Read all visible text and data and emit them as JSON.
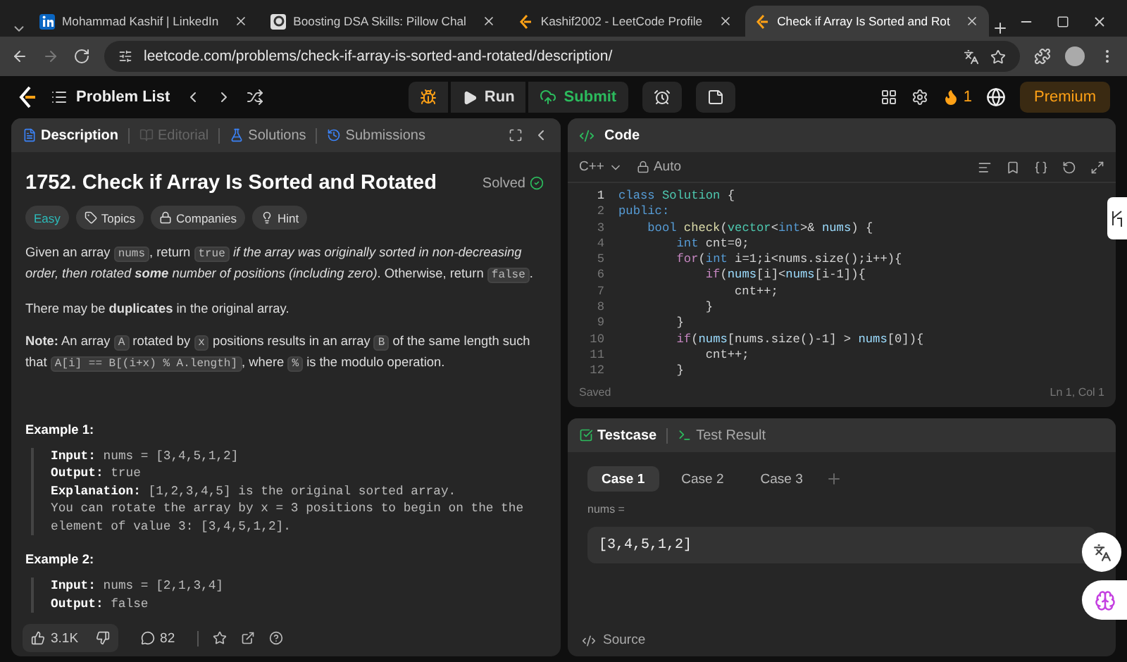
{
  "browser": {
    "tabs": [
      {
        "title": "Mohammad Kashif | LinkedIn",
        "kind": "linkedin",
        "selected": false
      },
      {
        "title": "Boosting DSA Skills: Pillow Chal",
        "kind": "chat",
        "selected": false
      },
      {
        "title": "Kashif2002 - LeetCode Profile",
        "kind": "leetcode",
        "selected": false
      },
      {
        "title": "Check if Array Is Sorted and Rot",
        "kind": "leetcode",
        "selected": true
      }
    ],
    "url": "leetcode.com/problems/check-if-array-is-sorted-and-rotated/description/"
  },
  "navbar": {
    "problem_list": "Problem List",
    "run": "Run",
    "submit": "Submit",
    "streak": "1",
    "premium": "Premium"
  },
  "description_panel": {
    "tabs": [
      {
        "label": "Description",
        "selected": true,
        "disabled": false
      },
      {
        "label": "Editorial",
        "selected": false,
        "disabled": true
      },
      {
        "label": "Solutions",
        "selected": false,
        "disabled": false
      },
      {
        "label": "Submissions",
        "selected": false,
        "disabled": false
      }
    ],
    "title": "1752. Check if Array Is Sorted and Rotated",
    "status": "Solved",
    "difficulty": "Easy",
    "chips": [
      "Topics",
      "Companies",
      "Hint"
    ],
    "paragraphs": [
      [
        {
          "kind": "text",
          "text": "Given an array "
        },
        {
          "kind": "code",
          "text": "nums"
        },
        {
          "kind": "text",
          "text": ", return "
        },
        {
          "kind": "code",
          "text": "true"
        },
        {
          "kind": "em",
          "text": "if the array was originally sorted in non-decreasing order, then rotated **some** number of positions (including zero)"
        },
        {
          "kind": "text",
          "text": ". Otherwise, return "
        },
        {
          "kind": "code",
          "text": "false"
        },
        {
          "kind": "text",
          "text": "."
        }
      ],
      [
        {
          "kind": "text",
          "text": "There may be **duplicates** in the original array."
        }
      ],
      [
        {
          "kind": "text",
          "text": "**Note:** An array "
        },
        {
          "kind": "code",
          "text": "A"
        },
        {
          "kind": "text",
          "text": " rotated by "
        },
        {
          "kind": "code",
          "text": "x"
        },
        {
          "kind": "text",
          "text": " positions results in an array "
        },
        {
          "kind": "code",
          "text": "B"
        },
        {
          "kind": "text",
          "text": " of the same length such that "
        },
        {
          "kind": "code",
          "text": "A[i] == B[(i+x) % A.length]"
        },
        {
          "kind": "text",
          "text": ", where "
        },
        {
          "kind": "code",
          "text": "%"
        },
        {
          "kind": "text",
          "text": " is the modulo operation."
        }
      ]
    ],
    "examples": [
      {
        "title": "Example 1:",
        "lines": [
          {
            "label": "Input:",
            "value": "nums = [3,4,5,1,2]"
          },
          {
            "label": "Output:",
            "value": "true"
          },
          {
            "label": "Explanation:",
            "value": "[1,2,3,4,5] is the original sorted array."
          },
          {
            "value": "You can rotate the array by x = 3 positions to begin on the the"
          },
          {
            "value": "element of value 3: [3,4,5,1,2]."
          }
        ]
      },
      {
        "title": "Example 2:",
        "lines": [
          {
            "label": "Input:",
            "value": "nums = [2,1,3,4]"
          },
          {
            "label": "Output:",
            "value": "false"
          }
        ]
      }
    ],
    "footer": {
      "likes": "3.1K",
      "comments": "82"
    }
  },
  "code_panel": {
    "title": "Code",
    "language": "C++",
    "mode": "Auto",
    "lines": [
      {
        "number": "1",
        "tokens": [
          {
            "kind": "keyword",
            "text": "class "
          },
          {
            "kind": "type",
            "text": "Solution"
          },
          {
            "kind": "plain",
            "text": " {"
          }
        ]
      },
      {
        "number": "2",
        "tokens": [
          {
            "kind": "keyword",
            "text": "public:"
          }
        ]
      },
      {
        "number": "3",
        "tokens": [
          {
            "kind": "keyword",
            "text": "    bool "
          },
          {
            "kind": "func",
            "text": "check"
          },
          {
            "kind": "plain",
            "text": "("
          },
          {
            "kind": "type",
            "text": "vector"
          },
          {
            "kind": "plain",
            "text": "<"
          },
          {
            "kind": "keyword",
            "text": "int"
          },
          {
            "kind": "plain",
            "text": ">& "
          },
          {
            "kind": "var",
            "text": "nums"
          },
          {
            "kind": "plain",
            "text": ") {"
          }
        ]
      },
      {
        "number": "4",
        "tokens": [
          {
            "kind": "keyword",
            "text": "        int"
          },
          {
            "kind": "plain",
            "text": " cnt=0;"
          }
        ]
      },
      {
        "number": "5",
        "tokens": [
          {
            "kind": "control",
            "text": "        for"
          },
          {
            "kind": "plain",
            "text": "("
          },
          {
            "kind": "keyword",
            "text": "int"
          },
          {
            "kind": "plain",
            "text": " i=1;i<nums.size();i++){"
          }
        ]
      },
      {
        "number": "6",
        "tokens": [
          {
            "kind": "control",
            "text": "            if"
          },
          {
            "kind": "plain",
            "text": "("
          },
          {
            "kind": "var",
            "text": "nums"
          },
          {
            "kind": "plain",
            "text": "[i]<"
          },
          {
            "kind": "var",
            "text": "nums"
          },
          {
            "kind": "plain",
            "text": "[i-1]){"
          }
        ]
      },
      {
        "number": "7",
        "tokens": [
          {
            "kind": "plain",
            "text": "                cnt++;"
          }
        ]
      },
      {
        "number": "8",
        "tokens": [
          {
            "kind": "plain",
            "text": "            }"
          }
        ]
      },
      {
        "number": "9",
        "tokens": [
          {
            "kind": "plain",
            "text": "        }"
          }
        ]
      },
      {
        "number": "10",
        "tokens": [
          {
            "kind": "control",
            "text": "        if"
          },
          {
            "kind": "plain",
            "text": "("
          },
          {
            "kind": "var",
            "text": "nums"
          },
          {
            "kind": "plain",
            "text": "[nums.size()-1] > "
          },
          {
            "kind": "var",
            "text": "nums"
          },
          {
            "kind": "plain",
            "text": "[0]){"
          }
        ]
      },
      {
        "number": "11",
        "tokens": [
          {
            "kind": "plain",
            "text": "            cnt++;"
          }
        ]
      },
      {
        "number": "12",
        "tokens": [
          {
            "kind": "plain",
            "text": "        }"
          }
        ]
      }
    ],
    "status": "Saved",
    "cursor": "Ln 1, Col 1"
  },
  "testcase_panel": {
    "tabs": [
      {
        "label": "Testcase",
        "selected": true
      },
      {
        "label": "Test Result",
        "selected": false
      }
    ],
    "cases": [
      {
        "label": "Case 1",
        "selected": true
      },
      {
        "label": "Case 2",
        "selected": false
      },
      {
        "label": "Case 3",
        "selected": false
      }
    ],
    "param_label": "nums =",
    "param_value": "[3,4,5,1,2]",
    "source": "Source"
  }
}
